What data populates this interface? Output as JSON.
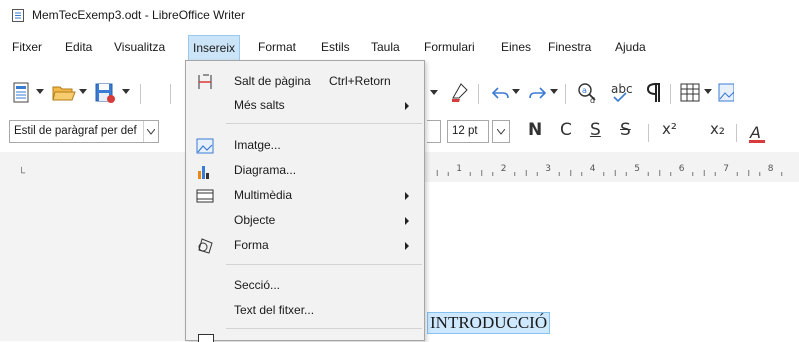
{
  "window": {
    "title": "MemTecExemp3.odt - LibreOffice Writer"
  },
  "menubar": {
    "items": [
      "Fitxer",
      "Edita",
      "Visualitza",
      "Insereix",
      "Format",
      "Estils",
      "Taula",
      "Formulari",
      "Eines",
      "Finestra",
      "Ajuda"
    ],
    "active": "Insereix"
  },
  "formatting": {
    "paragraph_style": "Estil de paràgraf per def",
    "font_size": "12 pt",
    "bold_label": "N",
    "italic_label": "C",
    "underline_label": "S",
    "strike_label": "S",
    "superscript_label": "x²",
    "subscript_label": "x₂"
  },
  "insert_menu": {
    "page_break": {
      "label": "Salt de pàgina",
      "shortcut": "Ctrl+Retorn"
    },
    "more_breaks": {
      "label": "Més salts"
    },
    "image": {
      "label": "Imatge..."
    },
    "chart": {
      "label": "Diagrama..."
    },
    "multimedia": {
      "label": "Multimèdia"
    },
    "object": {
      "label": "Objecte"
    },
    "shape": {
      "label": "Forma"
    },
    "section": {
      "label": "Secció..."
    },
    "text_from_file": {
      "label": "Text del fitxer..."
    }
  },
  "ruler": {
    "numbers": [
      "1",
      "2",
      "3",
      "4",
      "5",
      "6",
      "7",
      "8"
    ]
  },
  "document": {
    "heading": "INTRODUCCIÓ"
  },
  "colors": {
    "menu_highlight": "#cce4f7",
    "selection": "#cde8ff",
    "save_red": "#d83b3b",
    "chart_orange": "#e88a1a",
    "toolbar_blue": "#3a7bd5"
  }
}
